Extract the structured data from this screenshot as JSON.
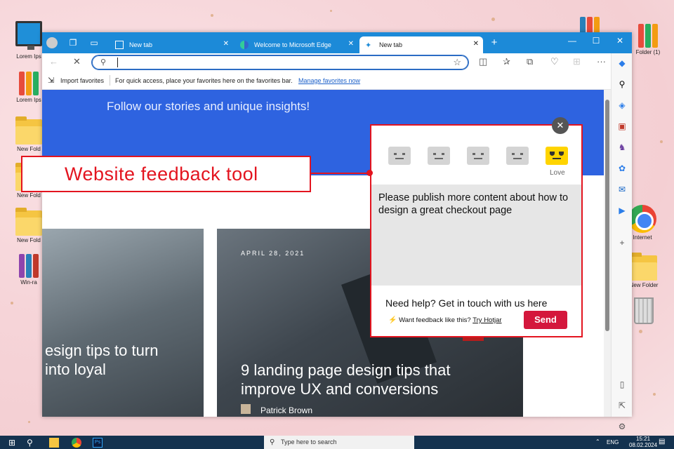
{
  "desktop": {
    "icons": [
      {
        "label": "Lorem Ips"
      },
      {
        "label": "Lorem Ips"
      },
      {
        "label": "New Fold"
      },
      {
        "label": "New Fold"
      },
      {
        "label": "New Fold"
      },
      {
        "label": "Win-ra"
      },
      {
        "label": "Folder (1)"
      },
      {
        "label": "Internet"
      },
      {
        "label": "New Folder"
      }
    ]
  },
  "browser": {
    "tabs": [
      {
        "label": "New tab"
      },
      {
        "label": "Welcome to Microsoft Edge"
      },
      {
        "label": "New tab"
      }
    ],
    "favorites": {
      "import_label": "Import favorites",
      "hint": "For quick access, place your favorites here on the favorites bar.",
      "manage_link": "Manage favorites now"
    },
    "page": {
      "hero_text": "Follow our stories and unique insights!",
      "card1_title": "esign tips to turn\ninto loyal",
      "card2_date": "APRIL 28, 2021",
      "card2_title": "9 landing page design tips that\nimprove UX and conversions",
      "card2_author": "Patrick Brown"
    }
  },
  "feedback": {
    "rating_selected": "Love",
    "comment": "Please publish more content about how to design a great checkout page",
    "help_text": "Need help? Get in touch with us here",
    "hotjar_text": "Want feedback like this?",
    "hotjar_link": "Try Hotjar",
    "send_label": "Send",
    "close_glyph": "✕"
  },
  "annotation": {
    "label": "Website feedback tool",
    "color": "#e3141f"
  },
  "taskbar": {
    "search_placeholder": "Type here to search",
    "lang": "ENG",
    "time": "15:21",
    "date": "08.02.2024"
  }
}
